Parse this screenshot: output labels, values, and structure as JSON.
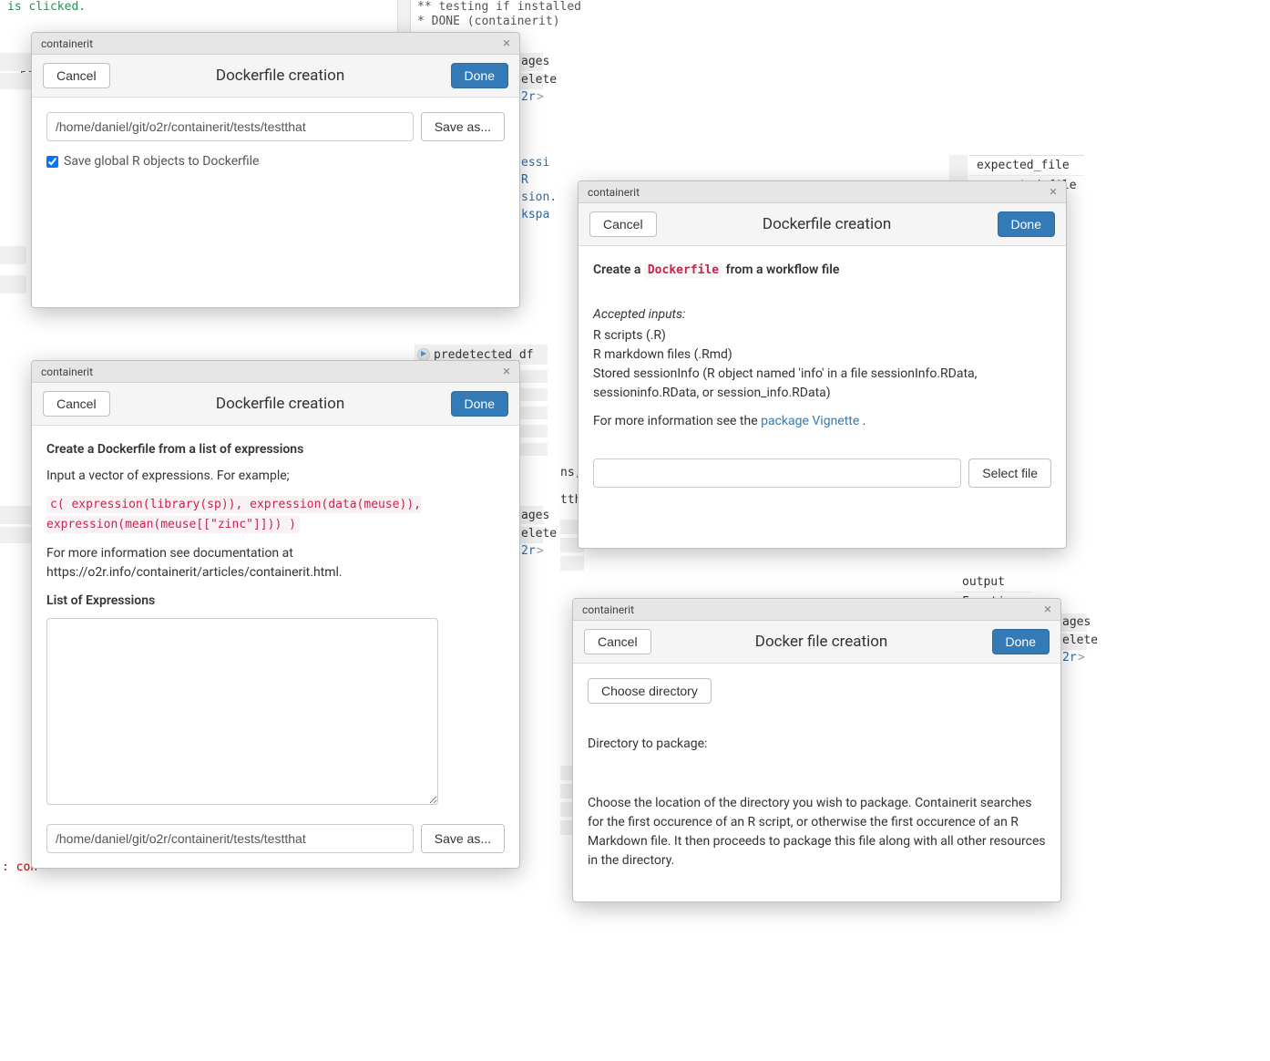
{
  "bg": {
    "clicked": "is clicked.",
    "pu": "pu",
    "testing": "** testing if installed",
    "done_cont": "* DONE (containerit)",
    "ages1": "ages",
    "elete1": "elete",
    "o2r1": "2r",
    "gt": ">",
    "essi": "essi",
    "R": "R",
    "sion": "sion.",
    "kspa": "kspa",
    "predetected": "predetected_df",
    "ns": "ns,",
    "ttha": "ttha",
    "con": ": con",
    "expected_file": "expected_file",
    "generated_file": "generated_file",
    "output": "output",
    "functions": "Functions"
  },
  "d1": {
    "window_title": "containerit",
    "header_title": "Dockerfile creation",
    "cancel": "Cancel",
    "done": "Done",
    "path": "/home/daniel/git/o2r/containerit/tests/testthat",
    "save_as": "Save as...",
    "checkbox_label": "Save global R objects to Dockerfile"
  },
  "d2": {
    "window_title": "containerit",
    "header_title": "Dockerfile creation",
    "cancel": "Cancel",
    "done": "Done",
    "subhead": "Create a Dockerfile from a list of expressions",
    "intro": "Input a vector of expressions. For example;",
    "code": "c( expression(library(sp)), expression(data(meuse)), expression(mean(meuse[[\"zinc\"]])) )",
    "more_info_1": "For more information see documentation at https://o2r.info/containerit/articles/containerit.html.",
    "list_label": "List of Expressions",
    "path": "/home/daniel/git/o2r/containerit/tests/testthat",
    "save_as": "Save as..."
  },
  "d3": {
    "window_title": "containerit",
    "header_title": "Dockerfile creation",
    "cancel": "Cancel",
    "done": "Done",
    "create_prefix": "Create a ",
    "dockerfile": "Dockerfile",
    "create_suffix": " from a workflow file",
    "accepted": "Accepted inputs:",
    "line1": "R scripts (.R)",
    "line2": "R markdown files (.Rmd)",
    "line3": "Stored sessionInfo (R object named 'info' in a file sessionInfo.RData, sessioninfo.RData, or session_info.RData)",
    "more_prefix": "For more information see the ",
    "link": "package Vignette",
    "more_suffix": " .",
    "select_file": "Select file"
  },
  "d4": {
    "window_title": "containerit",
    "header_title": "Docker file creation",
    "cancel": "Cancel",
    "done": "Done",
    "choose_dir": "Choose directory",
    "dir_label": "Directory to package:",
    "desc": "Choose the location of the directory you wish to package. Containerit searches for the first occurence of an R script, or otherwise the first occurence of an R Markdown file. It then proceeds to package this file along with all other resources in the directory."
  }
}
